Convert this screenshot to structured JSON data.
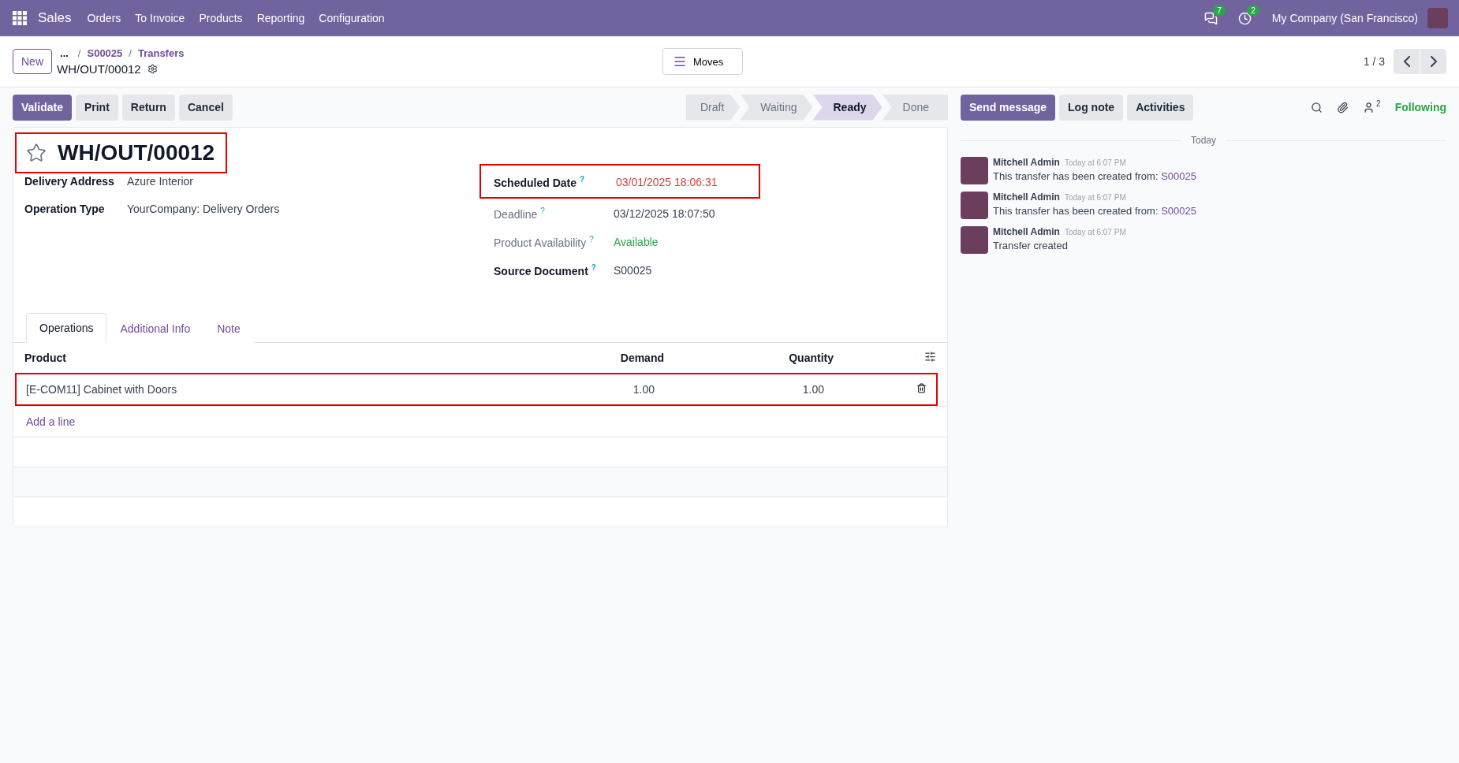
{
  "navbar": {
    "app": "Sales",
    "menu": [
      "Orders",
      "To Invoice",
      "Products",
      "Reporting",
      "Configuration"
    ],
    "messages_count": "7",
    "activities_count": "2",
    "company": "My Company (San Francisco)"
  },
  "control_panel": {
    "new_button": "New",
    "ellipsis": "...",
    "separator": "/",
    "breadcrumbs": [
      "S00025",
      "Transfers"
    ],
    "current": "WH/OUT/00012",
    "view_button": "Moves",
    "pager": "1 / 3"
  },
  "actions": [
    {
      "label": "Validate",
      "primary": true
    },
    {
      "label": "Print",
      "primary": false
    },
    {
      "label": "Return",
      "primary": false
    },
    {
      "label": "Cancel",
      "primary": false
    }
  ],
  "stages": [
    {
      "label": "Draft",
      "selected": false
    },
    {
      "label": "Waiting",
      "selected": false
    },
    {
      "label": "Ready",
      "selected": true
    },
    {
      "label": "Done",
      "selected": false
    }
  ],
  "record": {
    "title": "WH/OUT/00012",
    "starred": false,
    "title_highlighted": true,
    "left_fields": [
      {
        "label": "Delivery Address",
        "value": "Azure Interior"
      },
      {
        "label": "Operation Type",
        "value": "YourCompany: Delivery Orders"
      }
    ],
    "right_fields": [
      {
        "label": "Scheduled Date",
        "help": "?",
        "value": "03/01/2025 18:06:31",
        "readonly": false,
        "overdue": true,
        "positive": false,
        "highlighted": true
      },
      {
        "label": "Deadline",
        "help": "?",
        "value": "03/12/2025 18:07:50",
        "readonly": true,
        "overdue": false,
        "positive": false,
        "highlighted": false
      },
      {
        "label": "Product Availability",
        "help": "?",
        "value": "Available",
        "readonly": true,
        "overdue": false,
        "positive": true,
        "highlighted": false
      },
      {
        "label": "Source Document",
        "help": "?",
        "value": "S00025",
        "readonly": false,
        "overdue": false,
        "positive": false,
        "highlighted": false
      }
    ]
  },
  "tabs": [
    {
      "label": "Operations",
      "selected": true
    },
    {
      "label": "Additional Info",
      "selected": false
    },
    {
      "label": "Note",
      "selected": false
    }
  ],
  "table": {
    "columns": [
      "Product",
      "Demand",
      "Quantity"
    ],
    "rows": [
      {
        "cells": [
          "[E-COM11] Cabinet with Doors",
          "1.00",
          "1.00"
        ],
        "highlighted": true
      }
    ],
    "add_line": "Add a line"
  },
  "chatter": {
    "buttons": [
      {
        "label": "Send message",
        "primary": true
      },
      {
        "label": "Log note",
        "primary": false
      },
      {
        "label": "Activities",
        "primary": false
      }
    ],
    "follower_count": "2",
    "follow_label": "Following",
    "date_separator": "Today",
    "messages": [
      {
        "author": "Mitchell Admin",
        "time": "Today at 6:07 PM",
        "text": "This transfer has been created from: ",
        "link": "S00025"
      },
      {
        "author": "Mitchell Admin",
        "time": "Today at 6:07 PM",
        "text": "This transfer has been created from: ",
        "link": "S00025"
      },
      {
        "author": "Mitchell Admin",
        "time": "Today at 6:07 PM",
        "text": "Transfer created"
      }
    ]
  }
}
